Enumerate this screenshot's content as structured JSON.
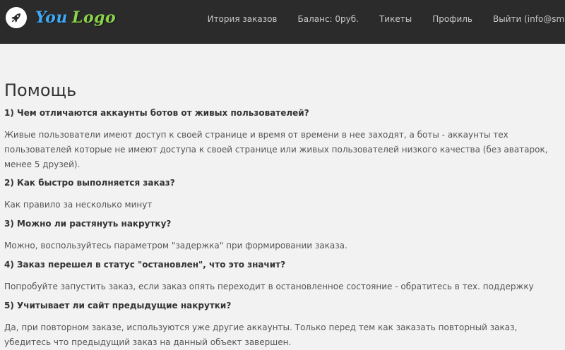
{
  "header": {
    "logo_word1": "You",
    "logo_word2": "Logo",
    "logo_icon": "rocket-icon",
    "nav": [
      {
        "label": "Итория заказов"
      },
      {
        "label": "Баланс: 0руб."
      },
      {
        "label": "Тикеты"
      },
      {
        "label": "Профиль"
      },
      {
        "label": "Выйти (info@sm..."
      }
    ],
    "colors": {
      "bar": "#2b2b2b",
      "logo_you": "#3fa9f5",
      "logo_logo": "#8bd34a"
    }
  },
  "page": {
    "title": "Помощь",
    "faq": [
      {
        "q": "1) Чем отличаются аккаунты ботов от живых пользователей?",
        "a": "Живые пользователи имеют доступ к своей странице и время от времени в нее заходят, а боты - аккаунты тех пользователей которые не имеют доступа к своей странице или живых пользователей низкого качества (без аватарок, менее 5 друзей)."
      },
      {
        "q": "2) Как быстро выполняется заказ?",
        "a": "Как правило за несколько минут"
      },
      {
        "q": "3) Можно ли растянуть накрутку?",
        "a": "Можно, воспользуйтесь параметром \"задержка\" при формировании заказа."
      },
      {
        "q": "4) Заказ перешел в статус \"остановлен\", что это значит?",
        "a": "Попробуйте запустить заказ, если заказ опять переходит в остановленное состояние - обратитесь в тех. поддержку"
      },
      {
        "q": "5) Учитывает ли сайт предыдущие накрутки?",
        "a": "Да, при повторном заказе, используются уже другие аккаунты. Только перед тем как заказать повторный заказ, убедитесь что предыдущий заказ на данный объект завершен."
      }
    ]
  }
}
